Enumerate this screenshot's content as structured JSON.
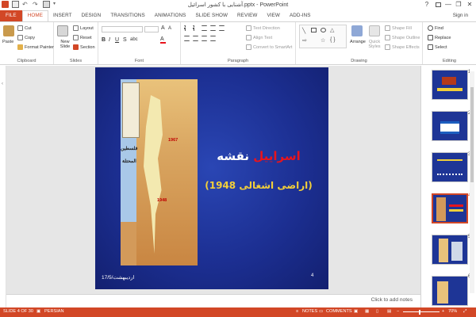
{
  "window": {
    "title": "آشنایی با کشور اسرائیل.pptx - PowerPoint",
    "help": "?",
    "minimize": "—",
    "restore": "❐",
    "close": "✕"
  },
  "tabs": [
    {
      "label": "FILE"
    },
    {
      "label": "HOME"
    },
    {
      "label": "INSERT"
    },
    {
      "label": "DESIGN"
    },
    {
      "label": "TRANSITIONS"
    },
    {
      "label": "ANIMATIONS"
    },
    {
      "label": "SLIDE SHOW"
    },
    {
      "label": "REVIEW"
    },
    {
      "label": "VIEW"
    },
    {
      "label": "ADD-INS"
    }
  ],
  "signin": "Sign in",
  "ribbon": {
    "clipboard": {
      "label": "Clipboard",
      "paste": "Paste",
      "cut": "Cut",
      "copy": "Copy",
      "format_painter": "Format Painter"
    },
    "slides": {
      "label": "Slides",
      "new_slide": "New Slide",
      "layout": "Layout",
      "reset": "Reset",
      "section": "Section"
    },
    "font": {
      "label": "Font"
    },
    "paragraph": {
      "label": "Paragraph",
      "text_direction": "Text Direction",
      "align_text": "Align Text",
      "convert_smartart": "Convert to SmartArt"
    },
    "drawing": {
      "label": "Drawing",
      "arrange": "Arrange",
      "quick_styles": "Quick Styles",
      "shape_fill": "Shape Fill",
      "shape_outline": "Shape Outline",
      "shape_effects": "Shape Effects"
    },
    "editing": {
      "label": "Editing",
      "find": "Find",
      "replace": "Replace",
      "select": "Select"
    }
  },
  "slide": {
    "title_black": "نقشه",
    "title_red": "اسراییل",
    "subtitle": "(اراضی اشغالی 1948)",
    "number": "4",
    "date": "17/اردیبهشت/5",
    "map": {
      "label_palestine": "فلسطين",
      "label_occupied": "المحتلة",
      "year_1967": "1967",
      "year_1948": "1948"
    }
  },
  "notes_placeholder": "Click to add notes",
  "thumbnails": [
    {
      "num": "1"
    },
    {
      "num": "2"
    },
    {
      "num": "3"
    },
    {
      "num": "4"
    },
    {
      "num": "5"
    },
    {
      "num": "6"
    }
  ],
  "status": {
    "slide_of": "SLIDE 4 OF 30",
    "language": "PERSIAN",
    "notes": "NOTES",
    "comments": "COMMENTS",
    "zoom": "70%"
  },
  "colors": {
    "accent": "#d24726",
    "slide_bg": "#1c2f92",
    "title_red": "#e8141c",
    "subtitle_yellow": "#f2cf3a"
  }
}
